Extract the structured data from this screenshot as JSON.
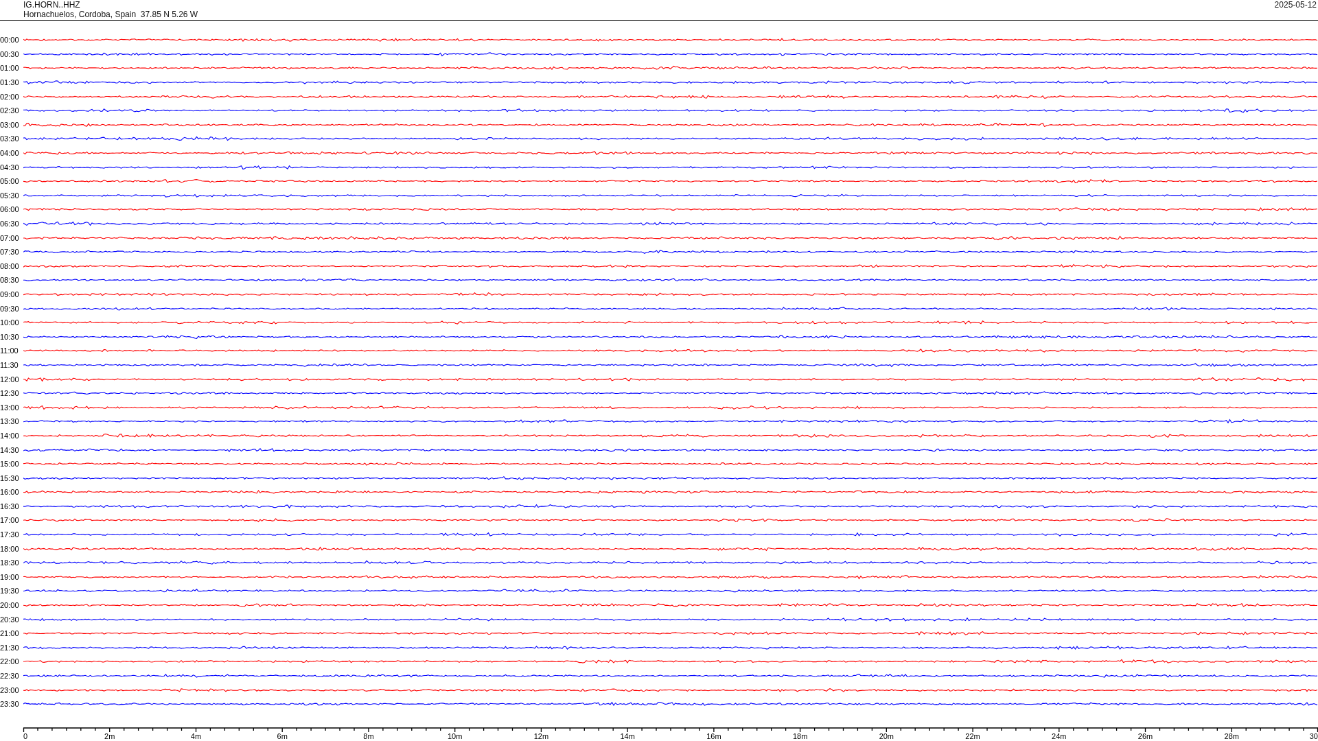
{
  "header": {
    "station": "IG.HORN..HHZ",
    "location": "Hornachuelos, Cordoba, Spain  37.85 N 5.26 W",
    "date": "2025-05-12"
  },
  "traces": [
    {
      "time": "00:00",
      "color": "#ff0000"
    },
    {
      "time": "00:30",
      "color": "#0000ff"
    },
    {
      "time": "01:00",
      "color": "#ff0000"
    },
    {
      "time": "01:30",
      "color": "#0000ff"
    },
    {
      "time": "02:00",
      "color": "#ff0000"
    },
    {
      "time": "02:30",
      "color": "#0000ff"
    },
    {
      "time": "03:00",
      "color": "#ff0000"
    },
    {
      "time": "03:30",
      "color": "#0000ff"
    },
    {
      "time": "04:00",
      "color": "#ff0000"
    },
    {
      "time": "04:30",
      "color": "#0000ff"
    },
    {
      "time": "05:00",
      "color": "#ff0000"
    },
    {
      "time": "05:30",
      "color": "#0000ff"
    },
    {
      "time": "06:00",
      "color": "#ff0000"
    },
    {
      "time": "06:30",
      "color": "#0000ff"
    },
    {
      "time": "07:00",
      "color": "#ff0000"
    },
    {
      "time": "07:30",
      "color": "#0000ff"
    },
    {
      "time": "08:00",
      "color": "#ff0000"
    },
    {
      "time": "08:30",
      "color": "#0000ff"
    },
    {
      "time": "09:00",
      "color": "#ff0000"
    },
    {
      "time": "09:30",
      "color": "#0000ff"
    },
    {
      "time": "10:00",
      "color": "#ff0000"
    },
    {
      "time": "10:30",
      "color": "#0000ff"
    },
    {
      "time": "11:00",
      "color": "#ff0000"
    },
    {
      "time": "11:30",
      "color": "#0000ff"
    },
    {
      "time": "12:00",
      "color": "#ff0000"
    },
    {
      "time": "12:30",
      "color": "#0000ff"
    },
    {
      "time": "13:00",
      "color": "#ff0000"
    },
    {
      "time": "13:30",
      "color": "#0000ff"
    },
    {
      "time": "14:00",
      "color": "#ff0000"
    },
    {
      "time": "14:30",
      "color": "#0000ff"
    },
    {
      "time": "15:00",
      "color": "#ff0000"
    },
    {
      "time": "15:30",
      "color": "#0000ff"
    },
    {
      "time": "16:00",
      "color": "#ff0000"
    },
    {
      "time": "16:30",
      "color": "#0000ff"
    },
    {
      "time": "17:00",
      "color": "#ff0000"
    },
    {
      "time": "17:30",
      "color": "#0000ff"
    },
    {
      "time": "18:00",
      "color": "#ff0000"
    },
    {
      "time": "18:30",
      "color": "#0000ff"
    },
    {
      "time": "19:00",
      "color": "#ff0000"
    },
    {
      "time": "19:30",
      "color": "#0000ff"
    },
    {
      "time": "20:00",
      "color": "#ff0000"
    },
    {
      "time": "20:30",
      "color": "#0000ff"
    },
    {
      "time": "21:00",
      "color": "#ff0000"
    },
    {
      "time": "21:30",
      "color": "#0000ff"
    },
    {
      "time": "22:00",
      "color": "#ff0000"
    },
    {
      "time": "22:30",
      "color": "#0000ff"
    },
    {
      "time": "23:00",
      "color": "#ff0000"
    },
    {
      "time": "23:30",
      "color": "#0000ff"
    }
  ],
  "time_axis": {
    "ticks": [
      "0",
      "2m",
      "4m",
      "6m",
      "8m",
      "10m",
      "12m",
      "14m",
      "16m",
      "18m",
      "20m",
      "22m",
      "24m",
      "26m",
      "28m",
      "30"
    ]
  }
}
